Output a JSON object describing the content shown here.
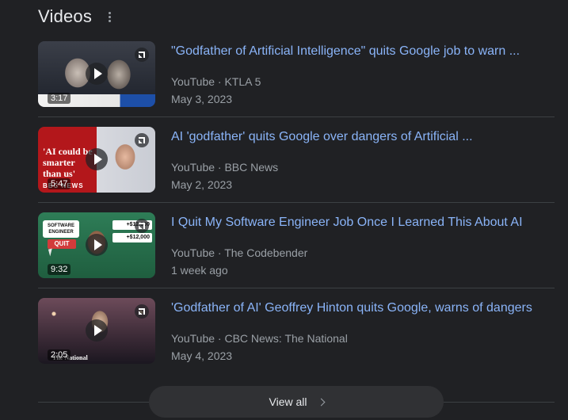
{
  "section": {
    "title": "Videos",
    "more_icon": "more-vert-icon"
  },
  "videos": [
    {
      "title": "\"Godfather of Artificial Intelligence\" quits Google job to warn ...",
      "source": "YouTube · KTLA 5",
      "date": "May 3, 2023",
      "duration": "3:17"
    },
    {
      "title": "AI 'godfather' quits Google over dangers of Artificial ...",
      "source": "YouTube · BBC News",
      "date": "May 2, 2023",
      "duration": "5:47",
      "thumb_text": "'AI could be smarter than us'",
      "thumb_brand": "BBC NEWS"
    },
    {
      "title": "I Quit My Software Engineer Job Once I Learned This About AI",
      "source": "YouTube · The Codebender",
      "date": "1 week ago",
      "duration": "9:32",
      "thumb_card": "SOFTWARE ENGINEER",
      "thumb_quit": "QUIT",
      "thumb_pay_1": "+$12,000",
      "thumb_pay_2": "+$12,000"
    },
    {
      "title": "'Godfather of AI' Geoffrey Hinton quits Google, warns of dangers",
      "source": "YouTube · CBC News: The National",
      "date": "May 4, 2023",
      "duration": "2:05",
      "thumb_brand": "The National"
    }
  ],
  "view_all": {
    "label": "View all"
  },
  "colors": {
    "background": "#202124",
    "link": "#8ab4f8",
    "meta": "#9aa0a6",
    "heading": "#e8eaed"
  }
}
